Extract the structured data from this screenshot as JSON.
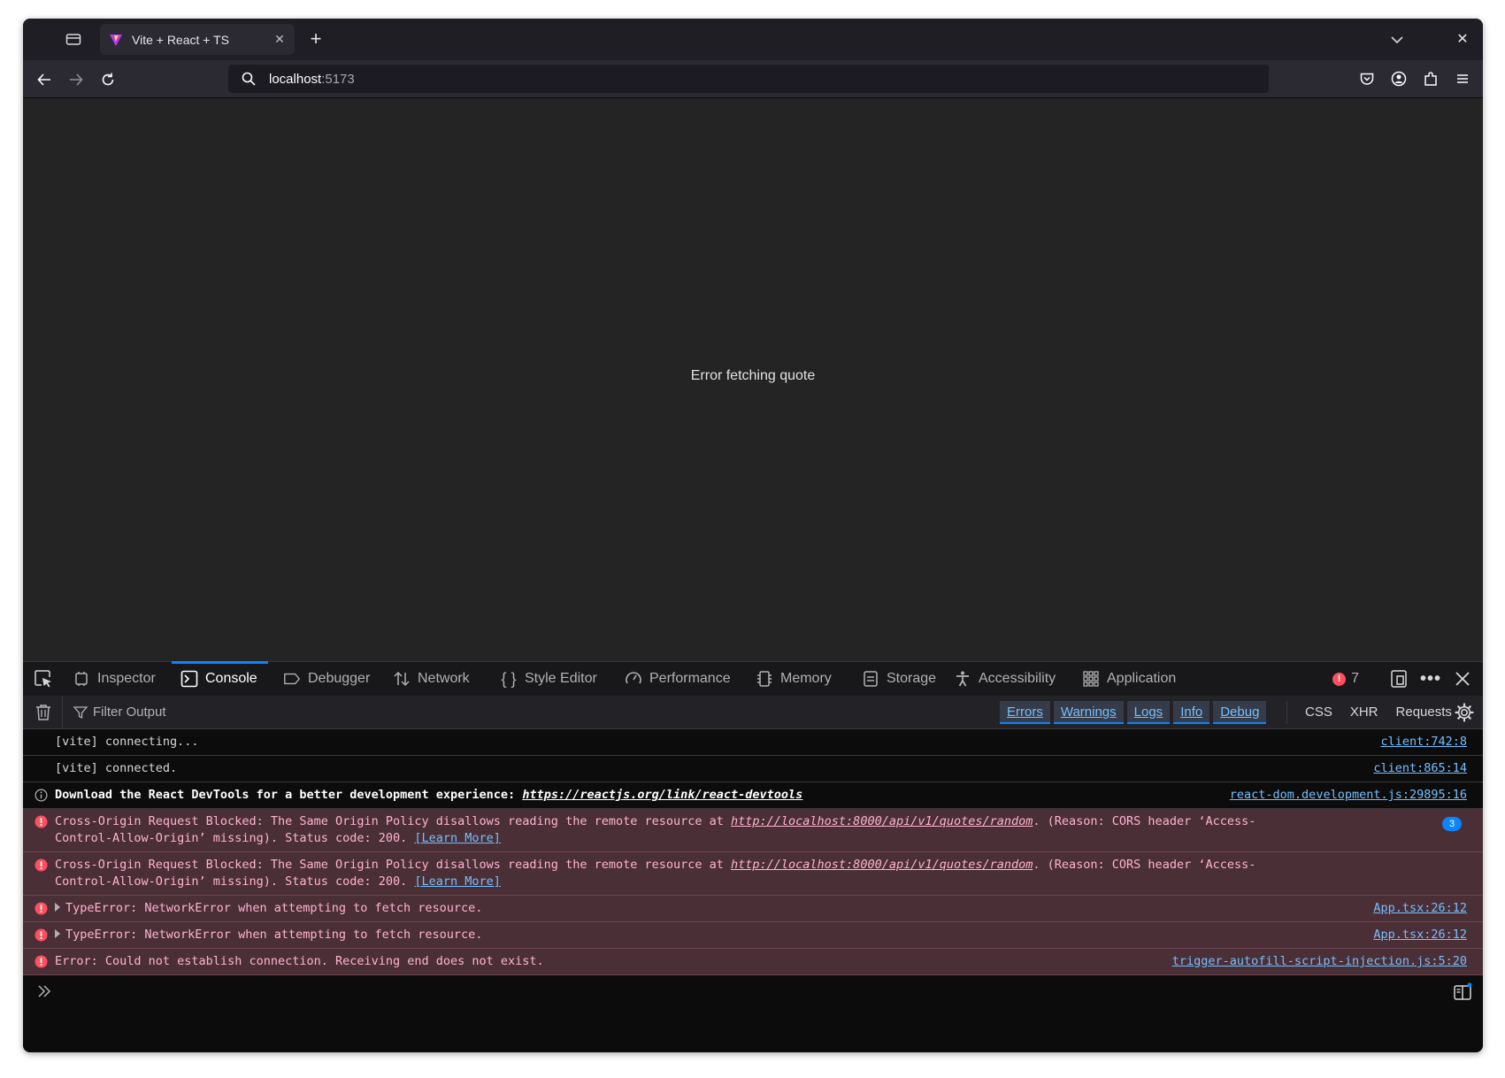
{
  "browser": {
    "tab_title": "Vite + React + TS",
    "url_host": "localhost",
    "url_port": ":5173"
  },
  "page": {
    "message": "Error fetching quote"
  },
  "devtools": {
    "tabs": [
      {
        "label": "Inspector",
        "icon": "inspector-icon"
      },
      {
        "label": "Console",
        "icon": "console-icon"
      },
      {
        "label": "Debugger",
        "icon": "debugger-icon"
      },
      {
        "label": "Network",
        "icon": "network-icon"
      },
      {
        "label": "Style Editor",
        "icon": "style-editor-icon"
      },
      {
        "label": "Performance",
        "icon": "performance-icon"
      },
      {
        "label": "Memory",
        "icon": "memory-icon"
      },
      {
        "label": "Storage",
        "icon": "storage-icon"
      },
      {
        "label": "Accessibility",
        "icon": "accessibility-icon"
      },
      {
        "label": "Application",
        "icon": "application-icon"
      }
    ],
    "selected_tab": "Console",
    "error_count": "7",
    "filter_placeholder": "Filter Output",
    "level_filters": [
      "Errors",
      "Warnings",
      "Logs",
      "Info",
      "Debug"
    ],
    "type_filters": [
      "CSS",
      "XHR",
      "Requests"
    ],
    "messages": [
      {
        "type": "log",
        "text": "[vite] connecting...",
        "source": "client:742:8"
      },
      {
        "type": "log",
        "text": "[vite] connected.",
        "source": "client:865:14"
      },
      {
        "type": "info",
        "text": "Download the React DevTools for a better development experience: ",
        "link": "https://reactjs.org/link/react-devtools",
        "source": "react-dom.development.js:29895:16"
      },
      {
        "type": "error",
        "text_a": "Cross-Origin Request Blocked: The Same Origin Policy disallows reading the remote resource at ",
        "link": "http://localhost:8000/api/v1/quotes/random",
        "text_b": ". (Reason: CORS header ‘Access-Control-Allow-Origin’ missing). Status code: 200. ",
        "learn_more": "[Learn More]",
        "repeat": "3"
      },
      {
        "type": "error",
        "text_a": "Cross-Origin Request Blocked: The Same Origin Policy disallows reading the remote resource at ",
        "link": "http://localhost:8000/api/v1/quotes/random",
        "text_b": ". (Reason: CORS header ‘Access-Control-Allow-Origin’ missing). Status code: 200. ",
        "learn_more": "[Learn More]"
      },
      {
        "type": "error",
        "text": "TypeError: NetworkError when attempting to fetch resource.",
        "source": "App.tsx:26:12"
      },
      {
        "type": "error",
        "text": "TypeError: NetworkError when attempting to fetch resource.",
        "source": "App.tsx:26:12"
      },
      {
        "type": "error",
        "text": "Error: Could not establish connection. Receiving end does not exist.",
        "source": "trigger-autofill-script-injection.js:5:20"
      }
    ]
  },
  "colors": {
    "accent": "#0a84ff",
    "error_bg": "#4b2f36",
    "error_icon": "#ff4f5e",
    "page_bg": "#242424"
  }
}
